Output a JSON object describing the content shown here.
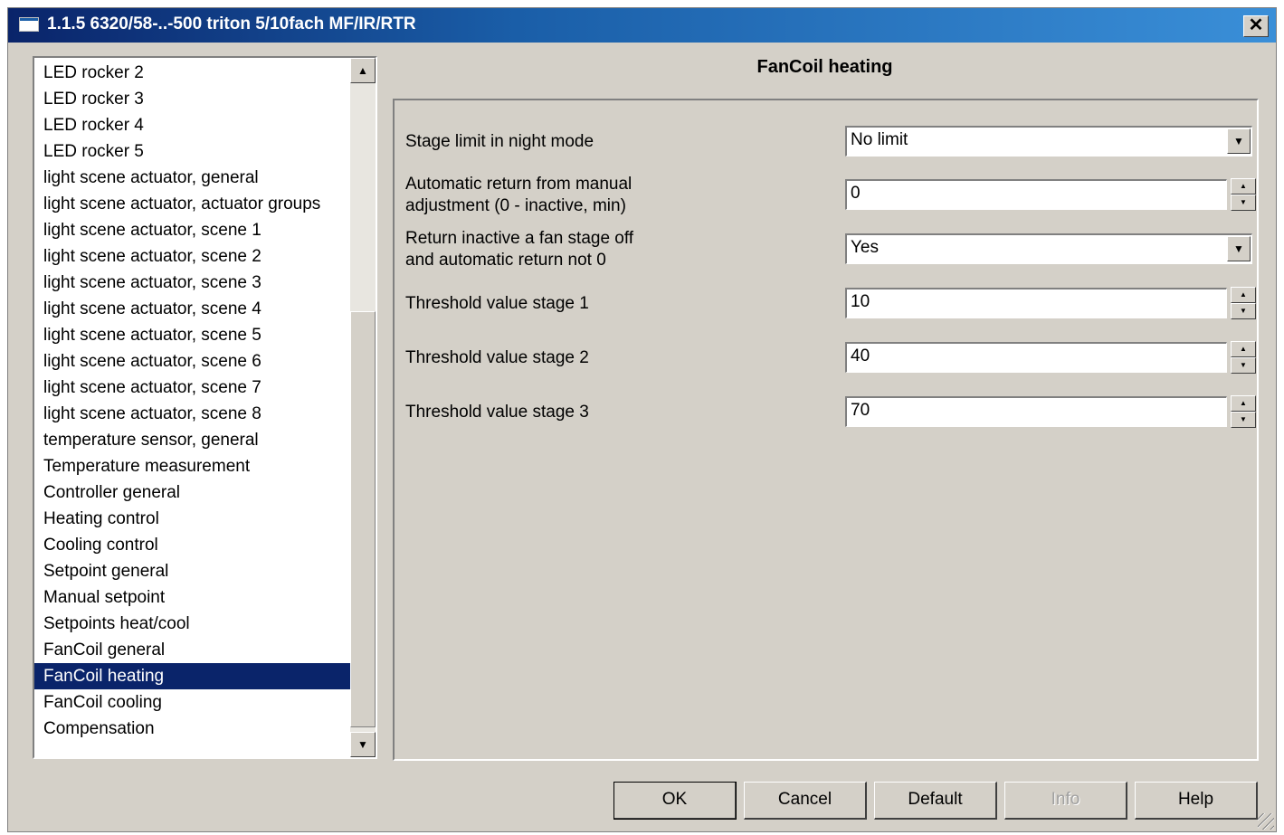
{
  "window": {
    "title": "1.1.5 6320/58-..-500 triton 5/10fach MF/IR/RTR",
    "close_glyph": "✕"
  },
  "tree": {
    "items": [
      {
        "label": "LED rocker 2"
      },
      {
        "label": "LED rocker 3"
      },
      {
        "label": "LED rocker 4"
      },
      {
        "label": "LED rocker 5"
      },
      {
        "label": "light scene actuator, general"
      },
      {
        "label": "light scene actuator, actuator groups"
      },
      {
        "label": "light scene actuator, scene 1"
      },
      {
        "label": "light scene actuator, scene 2"
      },
      {
        "label": "light scene actuator, scene 3"
      },
      {
        "label": "light scene actuator, scene 4"
      },
      {
        "label": "light scene actuator, scene 5"
      },
      {
        "label": "light scene actuator, scene 6"
      },
      {
        "label": "light scene actuator, scene 7"
      },
      {
        "label": "light scene actuator, scene 8"
      },
      {
        "label": "temperature sensor, general"
      },
      {
        "label": "Temperature measurement"
      },
      {
        "label": "Controller general"
      },
      {
        "label": "Heating control"
      },
      {
        "label": "Cooling control"
      },
      {
        "label": "Setpoint general"
      },
      {
        "label": "Manual setpoint"
      },
      {
        "label": "Setpoints heat/cool"
      },
      {
        "label": "FanCoil general"
      },
      {
        "label": "FanCoil heating",
        "selected": true
      },
      {
        "label": "FanCoil cooling"
      },
      {
        "label": "Compensation"
      }
    ]
  },
  "panel": {
    "title": "FanCoil heating",
    "params": {
      "stage_limit_night": {
        "label": "Stage limit in night mode",
        "value": "No limit"
      },
      "auto_return": {
        "label_line1": "Automatic return from manual",
        "label_line2": "adjustment (0 - inactive, min)",
        "value": "0"
      },
      "return_inactive": {
        "label_line1": "Return inactive a fan stage off",
        "label_line2": "and automatic return not 0",
        "value": "Yes"
      },
      "threshold_1": {
        "label": "Threshold value stage 1",
        "value": "10"
      },
      "threshold_2": {
        "label": "Threshold value stage 2",
        "value": "40"
      },
      "threshold_3": {
        "label": "Threshold value stage 3",
        "value": "70"
      }
    }
  },
  "buttons": {
    "ok": "OK",
    "cancel": "Cancel",
    "default": "Default",
    "info": "Info",
    "help": "Help"
  },
  "glyphs": {
    "arrow_up": "▲",
    "arrow_down": "▼"
  },
  "colors": {
    "selection": "#0a246a",
    "dialog_bg": "#d4d0c8"
  }
}
